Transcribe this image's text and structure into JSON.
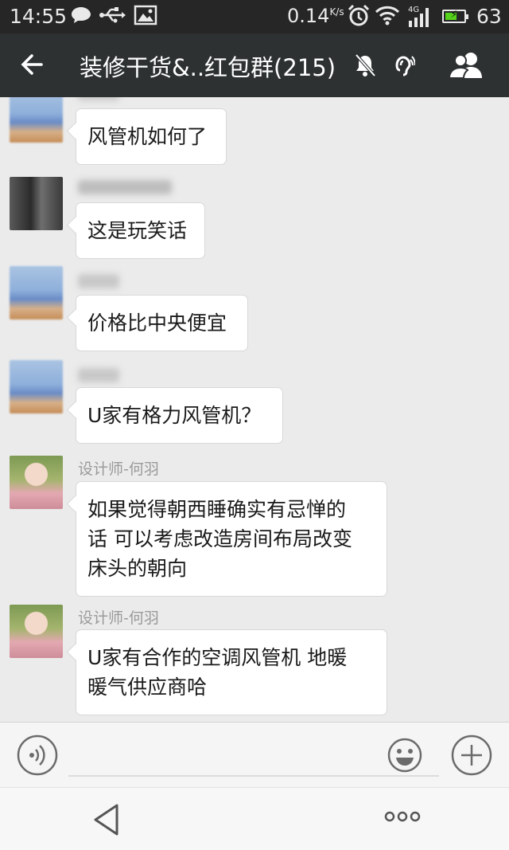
{
  "status_bar": {
    "time": "14:55",
    "net_speed": "0.14",
    "net_unit": "K/s",
    "network_type": "4G",
    "battery_percent": "63",
    "battery_level": 0.63,
    "icons": [
      "message-icon",
      "usb-icon",
      "image-icon",
      "alarm-icon",
      "wifi-icon",
      "signal-icon",
      "battery-icon"
    ]
  },
  "header": {
    "title": "装修干货&..红包群(215)",
    "icons": [
      "back-arrow-icon",
      "mute-icon",
      "earpiece-icon",
      "group-members-icon"
    ]
  },
  "messages": [
    {
      "sender": "",
      "text_lines": [
        "风管机如何了"
      ],
      "sender_hidden": true
    },
    {
      "sender": "",
      "text_lines": [
        "这是玩笑话"
      ],
      "sender_hidden": true
    },
    {
      "sender": "",
      "text_lines": [
        "价格比中央便宜"
      ],
      "sender_hidden": true
    },
    {
      "sender": "",
      "text_lines": [
        "U家有格力风管机？"
      ],
      "sender_hidden": true
    },
    {
      "sender": "设计师-何羽",
      "text_lines": [
        "如果觉得朝西睡确实有忌惮的",
        "话 可以考虑改造房间布局改变",
        "床头的朝向"
      ]
    },
    {
      "sender": "设计师-何羽",
      "text_lines": [
        "U家有合作的空调风管机 地暖",
        "暖气供应商哈"
      ]
    }
  ],
  "input_bar": {
    "placeholder": "",
    "value": "",
    "icons": [
      "voice-icon",
      "emoji-icon",
      "plus-icon"
    ]
  },
  "nav_bar": {
    "icons": [
      "nav-back-icon",
      "more-icon"
    ]
  },
  "colors": {
    "status_bar_bg": "#262626",
    "title_bar_bg": "#2d3132",
    "chat_bg": "#ebebeb",
    "bubble_bg": "#ffffff",
    "battery_fill": "#55d21c"
  }
}
